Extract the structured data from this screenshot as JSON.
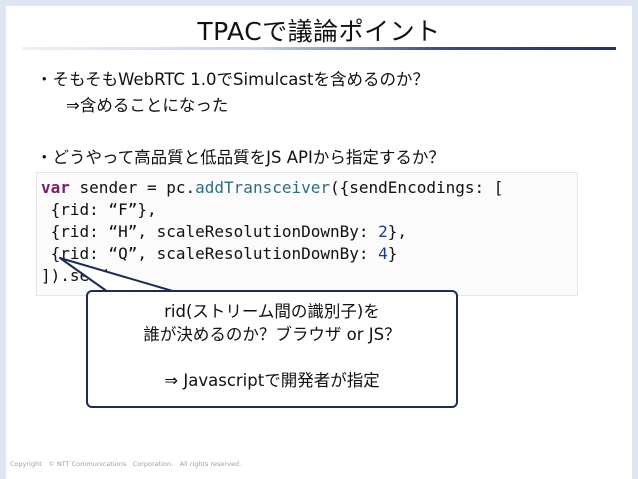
{
  "slide": {
    "title": "TPACで議論ポイント",
    "bullet1": "・そもそもWebRTC 1.0でSimulcastを含めるのか？",
    "bullet1_sub": "⇒含めることになった",
    "bullet2": "・どうやって高品質と低品質をJS APIから指定するか？"
  },
  "code": {
    "line1": {
      "kw": "var",
      "rest1": " sender = pc.",
      "fn": "addTransceiver",
      "rest2": "({sendEncodings: ["
    },
    "line2": " {rid: “F”},",
    "line3": {
      "a": " {rid: “H”, scaleResolutionDownBy: ",
      "num": "2",
      "b": "},"
    },
    "line4": {
      "a": " {rid: “Q”, scaleResolutionDownBy: ",
      "num": "4",
      "b": "}"
    },
    "line5": "]).send"
  },
  "callout": {
    "line1": "rid(ストリーム間の識別子)を",
    "line2": "誰が決めるのか？ブラウザ or JS？",
    "line3": "⇒ Javascriptで開発者が指定"
  },
  "footer": "Copyright　© NTT Communications　Corporation.　All rights reserved."
}
